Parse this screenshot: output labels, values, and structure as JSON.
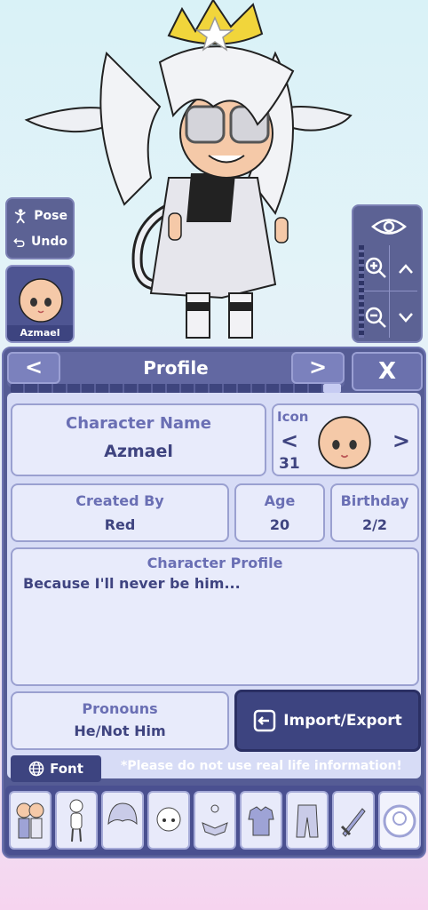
{
  "stage": {
    "pose_label": "Pose",
    "undo_label": "Undo",
    "current_character": "Azmael"
  },
  "panel": {
    "title": "Profile",
    "prev_label": "<",
    "next_label": ">",
    "close_label": "X"
  },
  "profile": {
    "character_name_label": "Character Name",
    "character_name": "Azmael",
    "icon_label": "Icon",
    "icon_prev": "<",
    "icon_next": ">",
    "icon_number": "31",
    "created_by_label": "Created By",
    "created_by": "Red",
    "age_label": "Age",
    "age": "20",
    "birthday_label": "Birthday",
    "birthday": "2/2",
    "character_profile_label": "Character Profile",
    "character_profile": "Because I'll never be him...",
    "pronouns_label": "Pronouns",
    "pronouns": "He/Not Him",
    "import_export_label": "Import/Export"
  },
  "footer": {
    "font_label": "Font",
    "warning": "*Please do not use real life information!"
  },
  "categories": [
    "presets",
    "body",
    "hair",
    "head",
    "accessories",
    "top",
    "bottom",
    "props",
    "profile"
  ],
  "colors": {
    "panel": "#555c95",
    "card": "#e8ebfb",
    "accent_text": "#6a6fb4",
    "value_text": "#3f4480"
  }
}
